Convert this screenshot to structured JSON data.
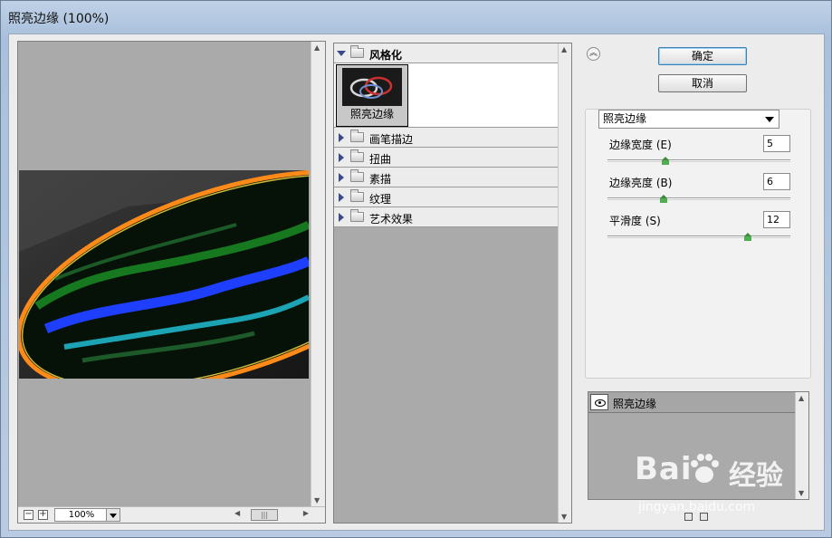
{
  "window": {
    "title": "照亮边缘 (100%)"
  },
  "preview": {
    "zoom_value": "100%",
    "zoom_out_label": "−",
    "zoom_in_label": "+"
  },
  "filter_browser": {
    "groups": [
      {
        "label": "风格化",
        "expanded": true
      },
      {
        "label": "画笔描边"
      },
      {
        "label": "扭曲"
      },
      {
        "label": "素描"
      },
      {
        "label": "纹理"
      },
      {
        "label": "艺术效果"
      }
    ],
    "selected_filter_label": "照亮边缘"
  },
  "buttons": {
    "ok": "确定",
    "cancel": "取消"
  },
  "settings": {
    "filter_select": "照亮边缘",
    "params": [
      {
        "label": "边缘宽度",
        "mnemonic": "(E)",
        "value": "5",
        "level": 0.31
      },
      {
        "label": "边缘亮度",
        "mnemonic": "(B)",
        "value": "6",
        "level": 0.3
      },
      {
        "label": "平滑度",
        "mnemonic": "(S)",
        "value": "12",
        "level": 0.78
      }
    ]
  },
  "layers": {
    "items": [
      {
        "label": "照亮边缘"
      }
    ]
  },
  "watermark": {
    "brand_left": "Bai",
    "brand_right": "经验",
    "url": "jingyan.baidu.com"
  }
}
